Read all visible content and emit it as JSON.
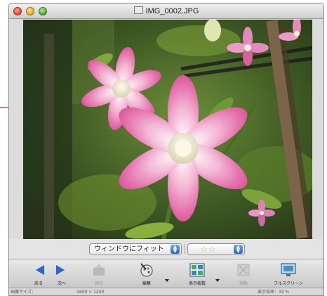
{
  "window": {
    "title": "IMG_0002.JPG"
  },
  "controls": {
    "fit_option": "ウィンドウにフィット",
    "rating": "☆☆"
  },
  "toolbar": {
    "back": "戻る",
    "next": "次へ",
    "save": "保存",
    "edit": "編集",
    "display_count": "表示枚数",
    "move": "移動",
    "fullscreen": "フルスクリーン"
  },
  "statusbar": {
    "size_label": "画像サイズ：",
    "size_value": "1600 × 1200",
    "zoom": "表示倍率：32 %"
  },
  "colors": {
    "accent_blue": "#2c66c8",
    "star": "#e2b21c",
    "callout": "#d23c28"
  }
}
